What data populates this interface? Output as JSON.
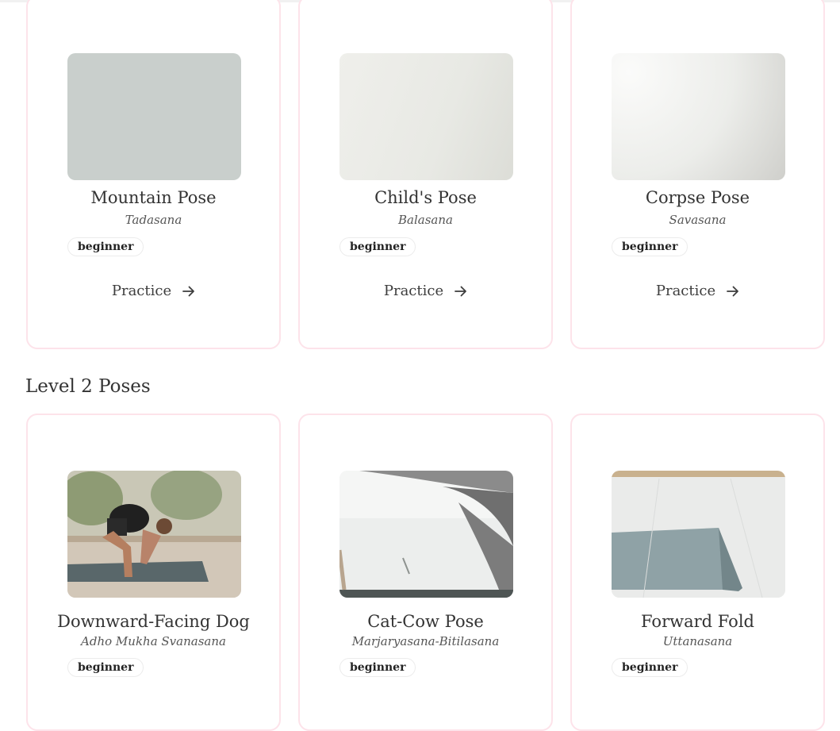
{
  "section": {
    "level2_title": "Level 2 Poses"
  },
  "row1": [
    {
      "name": "Mountain Pose",
      "sanskrit": "Tadasana",
      "level": "beginner",
      "cta": "Practice"
    },
    {
      "name": "Child's Pose",
      "sanskrit": "Balasana",
      "level": "beginner",
      "cta": "Practice"
    },
    {
      "name": "Corpse Pose",
      "sanskrit": "Savasana",
      "level": "beginner",
      "cta": "Practice"
    }
  ],
  "row2": [
    {
      "name": "Downward-Facing Dog",
      "sanskrit": "Adho Mukha Svanasana",
      "level": "beginner"
    },
    {
      "name": "Cat-Cow Pose",
      "sanskrit": "Marjaryasana-Bitilasana",
      "level": "beginner"
    },
    {
      "name": "Forward Fold",
      "sanskrit": "Uttanasana",
      "level": "beginner"
    }
  ],
  "icons": {
    "practice_arrow": "arrow-right-icon"
  },
  "colors": {
    "card_border": "#fde3ea",
    "text": "#333333"
  }
}
